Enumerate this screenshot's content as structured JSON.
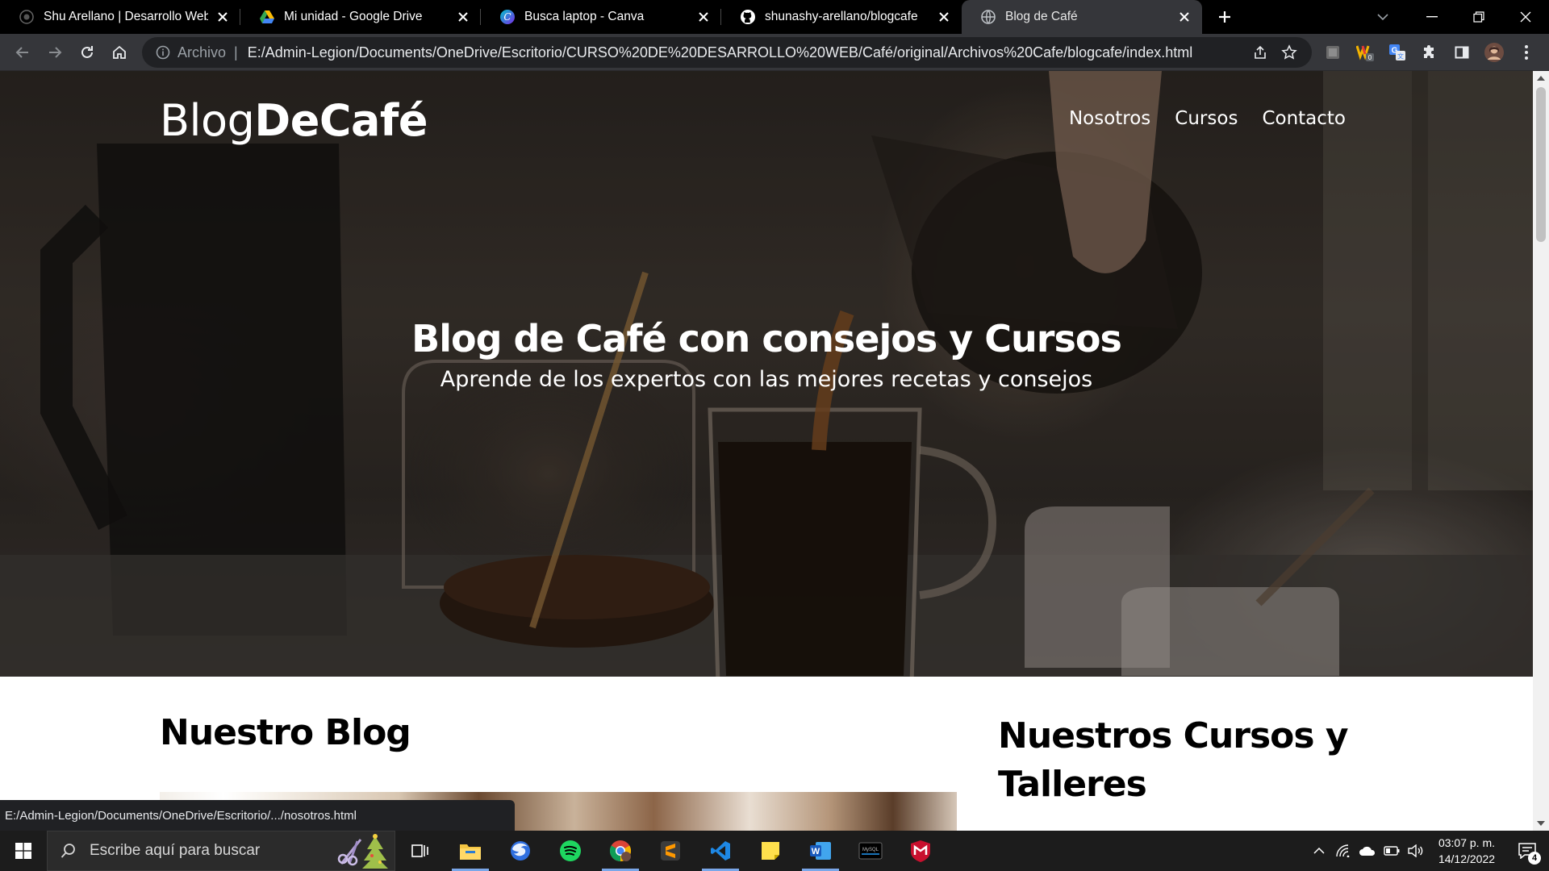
{
  "browser": {
    "tabs": [
      {
        "title": "Shu Arellano | Desarrollo Web Fr",
        "favicon": "dark-circle-icon",
        "active": false
      },
      {
        "title": "Mi unidad - Google Drive",
        "favicon": "google-drive-icon",
        "active": false
      },
      {
        "title": "Busca laptop - Canva",
        "favicon": "canva-icon",
        "active": false
      },
      {
        "title": "shunashy-arellano/blogcafe",
        "favicon": "github-icon",
        "active": false
      },
      {
        "title": "Blog de Café",
        "favicon": "globe-icon",
        "active": true
      }
    ],
    "address": {
      "scheme_label": "Archivo",
      "url": "E:/Admin-Legion/Documents/OneDrive/Escritorio/CURSO%20DE%20DESARROLLO%20WEB/Café/original/Archivos%20Cafe/blogcafe/index.html"
    },
    "status_url": "E:/Admin-Legion/Documents/OneDrive/Escritorio/.../nosotros.html",
    "colors": {
      "tabstrip": "#000000",
      "toolbar": "#35363a",
      "omnibox": "#202124"
    }
  },
  "page": {
    "brand_part1": "Blog",
    "brand_part2": "DeCafé",
    "nav": [
      "Nosotros",
      "Cursos",
      "Contacto"
    ],
    "hero_title": "Blog de Café con consejos y Cursos",
    "hero_subtitle": "Aprende de los expertos con las mejores recetas y consejos",
    "blog_heading": "Nuestro Blog",
    "courses_heading": "Nuestros Cursos y Talleres"
  },
  "taskbar": {
    "search_placeholder": "Escribe aquí para buscar",
    "apps": [
      "task-view-icon",
      "file-explorer-icon",
      "firefox-icon",
      "spotify-icon",
      "chrome-icon",
      "sublime-text-icon",
      "vscode-icon",
      "sticky-notes-icon",
      "word-icon",
      "mysql-icon",
      "mcafee-icon"
    ],
    "time": "03:07 p. m.",
    "date": "14/12/2022",
    "notification_count": "4"
  }
}
